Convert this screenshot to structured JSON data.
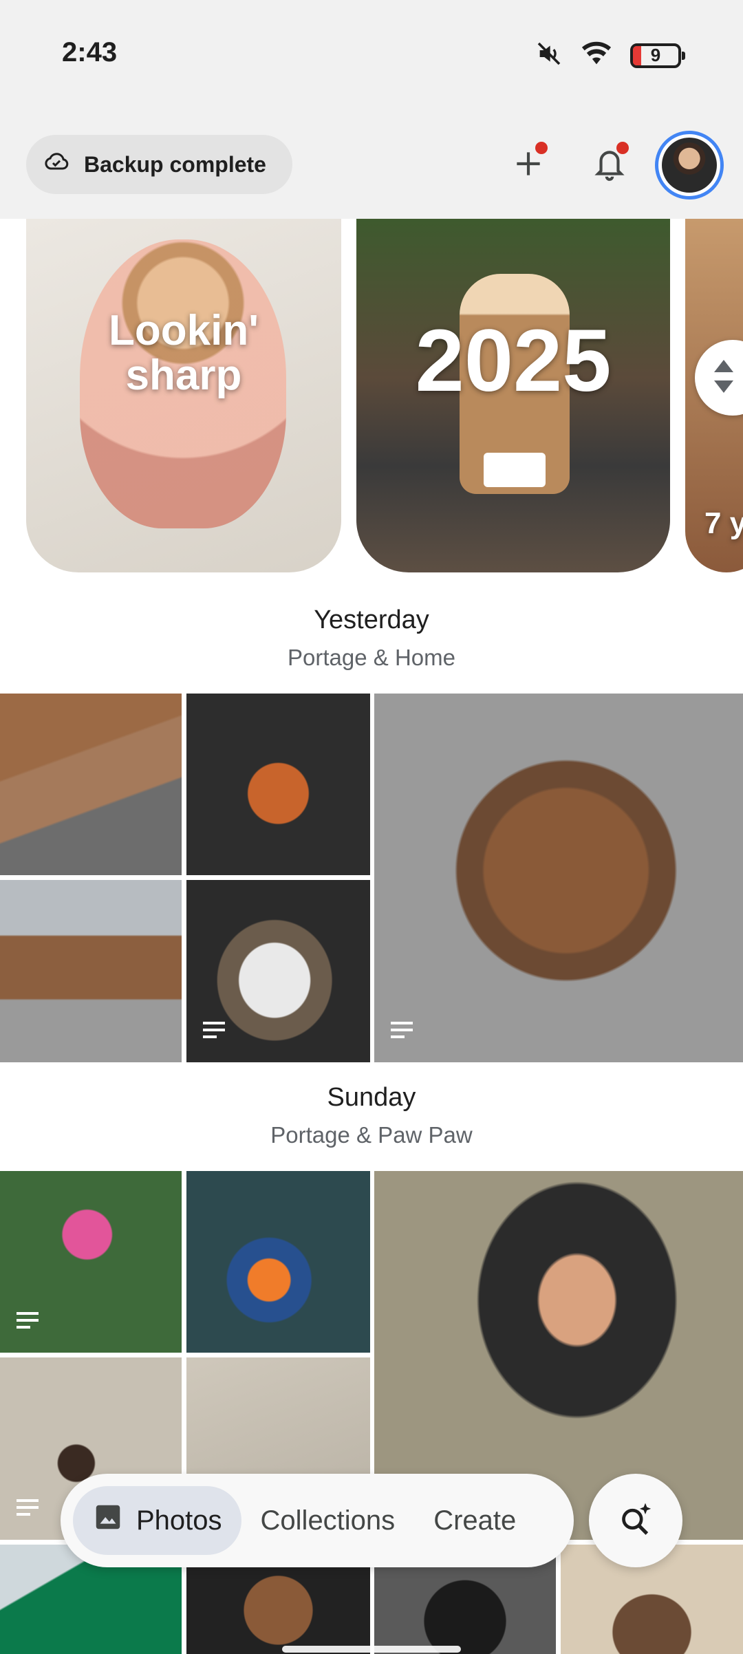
{
  "status_bar": {
    "time": "2:43",
    "battery_level": "9",
    "icons": [
      "mute-icon",
      "wifi-icon",
      "battery-icon"
    ]
  },
  "app_bar": {
    "backup_status": "Backup complete",
    "icons": [
      "cloud-check-icon",
      "add-icon",
      "bell-icon",
      "avatar"
    ]
  },
  "memories": [
    {
      "title": "Lookin' sharp"
    },
    {
      "title": "2025"
    },
    {
      "title": "7 y"
    }
  ],
  "sections": [
    {
      "title": "Yesterday",
      "subtitle": "Portage & Home"
    },
    {
      "title": "Sunday",
      "subtitle": "Portage & Paw Paw"
    }
  ],
  "bottom_nav": {
    "items": [
      {
        "label": "Photos",
        "active": true
      },
      {
        "label": "Collections",
        "active": false
      },
      {
        "label": "Create",
        "active": false
      }
    ],
    "search_icon": "search-sparkle-icon"
  },
  "colors": {
    "accent": "#4285f4",
    "notification_dot": "#d93025",
    "active_tab_bg": "#dfe3eb"
  }
}
